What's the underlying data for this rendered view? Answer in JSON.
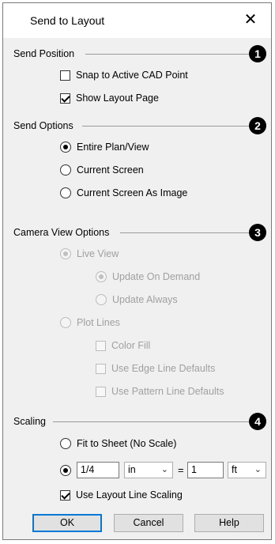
{
  "window": {
    "title": "Send to Layout",
    "close_glyph": "✕"
  },
  "sections": {
    "send_position": {
      "label": "Send Position",
      "badge": "1"
    },
    "send_options": {
      "label": "Send Options",
      "badge": "2"
    },
    "camera_view": {
      "label": "Camera View Options",
      "badge": "3"
    },
    "scaling": {
      "label": "Scaling",
      "badge": "4"
    }
  },
  "send_position": {
    "snap_cad": {
      "label": "Snap to Active CAD Point",
      "checked": false
    },
    "show_layout": {
      "label": "Show Layout Page",
      "checked": true
    }
  },
  "send_options": {
    "entire_plan": {
      "label": "Entire Plan/View",
      "selected": true
    },
    "current_screen": {
      "label": "Current Screen",
      "selected": false
    },
    "screen_image": {
      "label": "Current Screen As Image",
      "selected": false
    }
  },
  "camera_view": {
    "live_view": {
      "label": "Live View",
      "selected": true,
      "enabled": false
    },
    "update_demand": {
      "label": "Update On Demand",
      "selected": true,
      "enabled": false
    },
    "update_always": {
      "label": "Update Always",
      "selected": false,
      "enabled": false
    },
    "plot_lines": {
      "label": "Plot Lines",
      "selected": false,
      "enabled": false
    },
    "color_fill": {
      "label": "Color Fill",
      "checked": false,
      "enabled": false
    },
    "edge_defaults": {
      "label": "Use Edge Line Defaults",
      "checked": false,
      "enabled": false
    },
    "pattern_defaults": {
      "label": "Use Pattern Line Defaults",
      "checked": false,
      "enabled": false
    }
  },
  "scaling": {
    "fit_sheet": {
      "label": "Fit to Sheet (No Scale)",
      "selected": false
    },
    "scale_ratio": {
      "selected": true
    },
    "left_value": "1/4",
    "left_unit": "in",
    "equals": "=",
    "right_value": "1",
    "right_unit": "ft",
    "layout_line_scaling": {
      "label": "Use Layout Line Scaling",
      "checked": true
    }
  },
  "buttons": {
    "ok": "OK",
    "cancel": "Cancel",
    "help": "Help"
  },
  "icons": {
    "close": "close-icon",
    "dropdown": "chevron-down-icon"
  },
  "colors": {
    "default_button_border": "#0078d7",
    "disabled_text": "#a0a0a0"
  }
}
